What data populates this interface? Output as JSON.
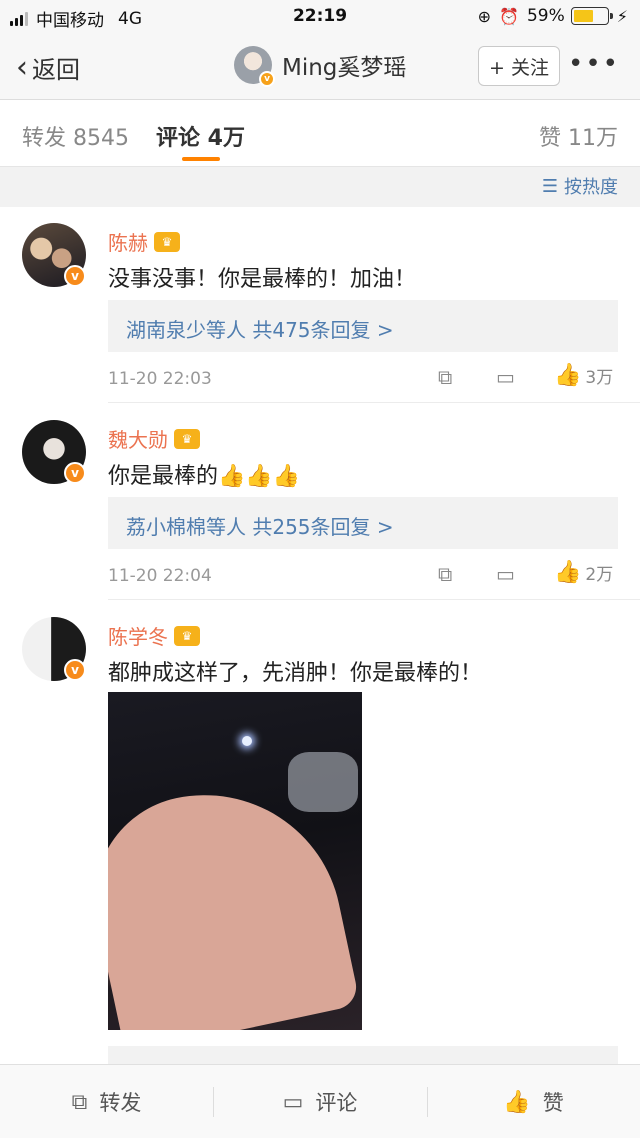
{
  "status_bar": {
    "carrier": "中国移动",
    "network": "4G",
    "time": "22:19",
    "battery": "59%",
    "battery_level": 0.59
  },
  "nav": {
    "back_label": "返回",
    "username": "Ming奚梦瑶",
    "follow_label": "+ 关注",
    "more_label": "•••"
  },
  "tabs": {
    "repost": "转发 8545",
    "comment": "评论 4万",
    "like": "赞 11万"
  },
  "sort_label": "按热度",
  "comments": [
    {
      "name": "陈赫",
      "text": "没事没事！你是最棒的！加油！",
      "replies": "湖南泉少等人 共475条回复 >",
      "time": "11-20 22:03",
      "likes": "3万"
    },
    {
      "name": "魏大勋",
      "text": "你是最棒的",
      "emoji": "👍👍👍",
      "replies": "荔小棉棉等人 共255条回复 >",
      "time": "11-20 22:04",
      "likes": "2万"
    },
    {
      "name": "陈学冬",
      "text": "都肿成这样了，先消肿！你是最棒的！"
    }
  ],
  "bottom_bar": {
    "repost": "转发",
    "comment": "评论",
    "like": "赞"
  },
  "colors": {
    "accent": "#ff8200",
    "link": "#507daf",
    "name": "#eb7350"
  }
}
